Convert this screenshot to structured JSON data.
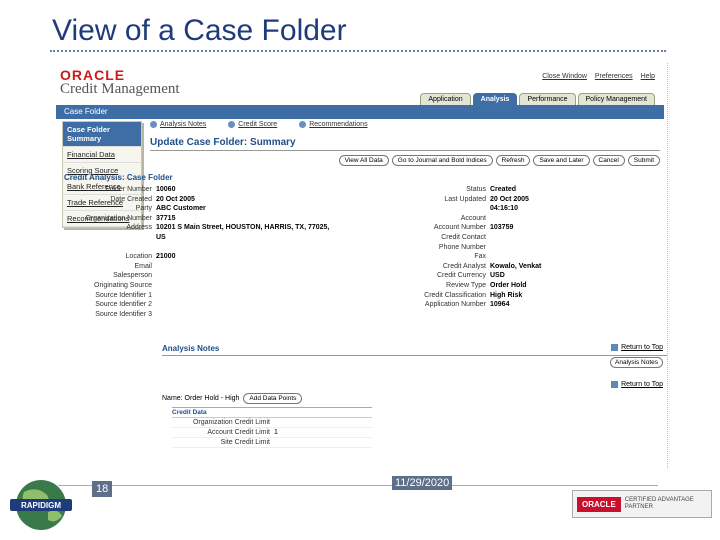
{
  "slide": {
    "title": "View of a Case Folder",
    "page_number": "18",
    "date": "11/29/2020",
    "footer_logo": "RAPIDIGM",
    "partner": {
      "brand": "ORACLE",
      "line1": "CERTIFIED ADVANTAGE",
      "line2": "PARTNER"
    }
  },
  "app": {
    "brand": {
      "oracle": "ORACLE",
      "product": "Credit Management"
    },
    "top_links": [
      "Close Window",
      "Preferences",
      "Help"
    ],
    "tabs": [
      {
        "label": "Application",
        "active": false
      },
      {
        "label": "Analysis",
        "active": true
      },
      {
        "label": "Performance",
        "active": false
      },
      {
        "label": "Policy Management",
        "active": false
      }
    ],
    "bar_label": "Case Folder",
    "sidebar": [
      {
        "label": "Case Folder Summary",
        "active": true
      },
      {
        "label": "Financial Data",
        "active": false
      },
      {
        "label": "Scoring Source",
        "active": false
      },
      {
        "label": "Bank Reference",
        "active": false
      },
      {
        "label": "Trade Reference",
        "active": false
      },
      {
        "label": "Recommendations",
        "active": false
      }
    ],
    "quick_links": [
      "Analysis Notes",
      "Credit Score",
      "Recommendations"
    ],
    "heading": "Update Case Folder: Summary",
    "buttons": [
      "View All Data",
      "Go to Journal and Bold Indices",
      "Refresh",
      "Save and Later",
      "Cancel",
      "Submit"
    ],
    "section_title": "Credit Analysis: Case Folder",
    "left_fields": [
      {
        "label": "Folder Number",
        "value": "10060"
      },
      {
        "label": "Date Created",
        "value": "20 Oct 2005"
      },
      {
        "label": "Party",
        "value": "ABC Customer"
      },
      {
        "label": "Organization Number",
        "value": "37715"
      },
      {
        "label": "Address",
        "value": "10201 S Main Street, HOUSTON, HARRIS, TX, 77025,"
      },
      {
        "label": "",
        "value": "US"
      },
      {
        "label": "",
        "value": ""
      },
      {
        "label": "Location",
        "value": "21000"
      },
      {
        "label": "Email",
        "value": ""
      },
      {
        "label": "Salesperson",
        "value": ""
      },
      {
        "label": "Originating Source",
        "value": ""
      },
      {
        "label": "Source Identifier 1",
        "value": ""
      },
      {
        "label": "Source Identifier 2",
        "value": ""
      },
      {
        "label": "Source Identifier 3",
        "value": ""
      }
    ],
    "right_fields": [
      {
        "label": "Status",
        "value": "Created"
      },
      {
        "label": "Last Updated",
        "value": "20 Oct 2005"
      },
      {
        "label": "",
        "value": "04:16:10"
      },
      {
        "label": "Account",
        "value": ""
      },
      {
        "label": "Account Number",
        "value": "103759"
      },
      {
        "label": "Credit Contact",
        "value": ""
      },
      {
        "label": "Phone Number",
        "value": ""
      },
      {
        "label": "Fax",
        "value": ""
      },
      {
        "label": "Credit Analyst",
        "value": "Kowalo, Venkat"
      },
      {
        "label": "Credit Currency",
        "value": "USD"
      },
      {
        "label": "Review Type",
        "value": "Order Hold"
      },
      {
        "label": "Credit Classification",
        "value": "High Risk"
      },
      {
        "label": "Application Number",
        "value": "10964"
      }
    ],
    "return_to_top": "Return to Top",
    "analysis_notes_title": "Analysis Notes",
    "analysis_notes_button": "Analysis Notes",
    "name_row": {
      "label": "Name: Order Hold - High",
      "button": "Add Data Points"
    },
    "credit_table": {
      "header": "Credit Data",
      "rows": [
        {
          "label": "Organization Credit Limit",
          "value": ""
        },
        {
          "label": "Account Credit Limit",
          "value": "1"
        },
        {
          "label": "Site Credit Limit",
          "value": ""
        }
      ]
    }
  }
}
